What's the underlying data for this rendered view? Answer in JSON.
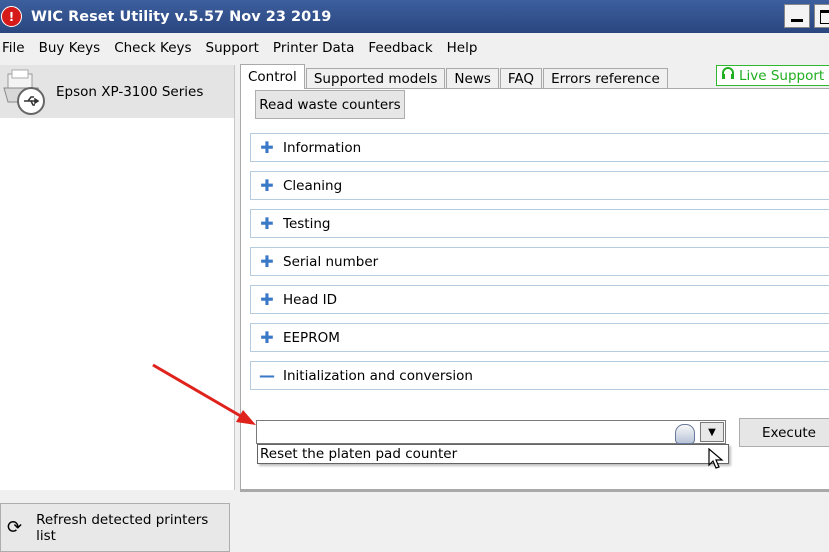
{
  "window": {
    "title": "WIC Reset Utility v.5.57 Nov 23 2019",
    "icon": "stop-icon",
    "icon_glyph": "!"
  },
  "menu": [
    "File",
    "Buy Keys",
    "Check Keys",
    "Support",
    "Printer Data",
    "Feedback",
    "Help"
  ],
  "printers": {
    "selected": "Epson XP-3100 Series",
    "icon": "usb-printer-icon"
  },
  "refresh_button": {
    "label": "Refresh detected printers list",
    "icon": "refresh-icon",
    "icon_glyph": "⟳"
  },
  "tabs": [
    "Control",
    "Supported models",
    "News",
    "FAQ",
    "Errors reference"
  ],
  "active_tab": "Control",
  "live_support": {
    "label": "Live Support is",
    "icon": "headset-icon",
    "color": "#1fae1f"
  },
  "read_waste_counters": "Read waste counters",
  "sections": [
    {
      "label": "Information",
      "state": "collapsed",
      "glyph": "✚"
    },
    {
      "label": "Cleaning",
      "state": "collapsed",
      "glyph": "✚"
    },
    {
      "label": "Testing",
      "state": "collapsed",
      "glyph": "✚"
    },
    {
      "label": "Serial number",
      "state": "collapsed",
      "glyph": "✚"
    },
    {
      "label": "Head ID",
      "state": "collapsed",
      "glyph": "✚"
    },
    {
      "label": "EEPROM",
      "state": "collapsed",
      "glyph": "✚"
    },
    {
      "label": "Initialization and conversion",
      "state": "expanded",
      "glyph": "—"
    }
  ],
  "init_combo": {
    "value": "",
    "options": [
      "Reset the platen pad counter"
    ],
    "dropdown_glyph": "▼"
  },
  "execute_label": "Execute",
  "colors": {
    "titlebar": "#29467f",
    "accent_arrow": "#e0221c",
    "section_icon": "#3a78c8"
  }
}
